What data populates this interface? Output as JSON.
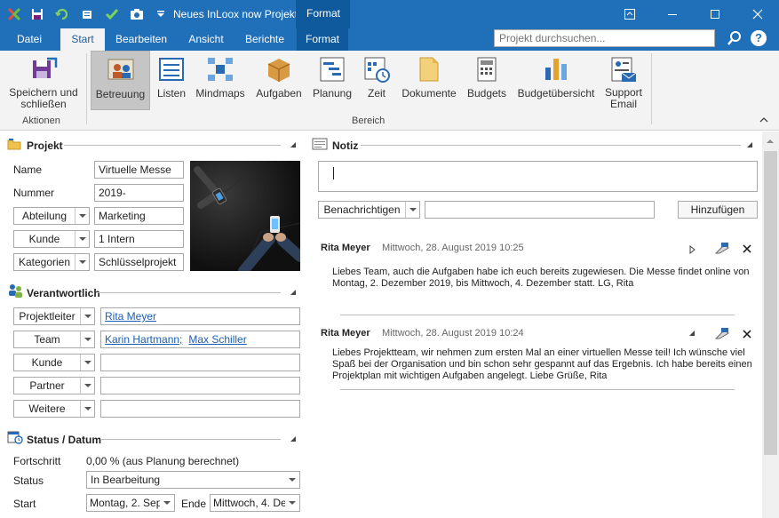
{
  "window": {
    "title": "Neues InLoox now Projekt",
    "context_tab": "Format",
    "colors": {
      "titlebar": "#1f6fb9",
      "context": "#0f5a9c",
      "ribbon": "#f3f3f3",
      "link": "#1a5fb4"
    }
  },
  "quick_access": [
    {
      "name": "app-logo-icon"
    },
    {
      "name": "save-icon"
    },
    {
      "name": "refresh-icon"
    },
    {
      "name": "print-icon"
    },
    {
      "name": "check-icon"
    },
    {
      "name": "camera-icon"
    },
    {
      "name": "customize-dropdown-icon"
    }
  ],
  "tabs": [
    {
      "label": "Datei"
    },
    {
      "label": "Start"
    },
    {
      "label": "Bearbeiten"
    },
    {
      "label": "Ansicht"
    },
    {
      "label": "Berichte"
    },
    {
      "label": "Format"
    }
  ],
  "search": {
    "placeholder": "Projekt durchsuchen..."
  },
  "ribbon": {
    "groups": {
      "actions": "Aktionen",
      "area": "Bereich"
    },
    "buttons": [
      {
        "label": "Speichern und schließen",
        "icon": "save-close-icon"
      },
      {
        "label": "Betreuung",
        "icon": "management-icon"
      },
      {
        "label": "Listen",
        "icon": "lists-icon"
      },
      {
        "label": "Mindmaps",
        "icon": "mindmap-icon"
      },
      {
        "label": "Aufgaben",
        "icon": "tasks-icon"
      },
      {
        "label": "Planung",
        "icon": "planning-icon"
      },
      {
        "label": "Zeit",
        "icon": "time-icon"
      },
      {
        "label": "Dokumente",
        "icon": "documents-icon"
      },
      {
        "label": "Budgets",
        "icon": "budgets-icon"
      },
      {
        "label": "Budgetübersicht",
        "icon": "budget-overview-icon"
      },
      {
        "label": "Support Email",
        "icon": "support-email-icon"
      }
    ]
  },
  "project": {
    "heading": "Projekt",
    "name_label": "Name",
    "name_value": "Virtuelle Messe",
    "number_label": "Nummer",
    "number_value": "2019-",
    "department_label": "Abteilung",
    "department_value": "Marketing",
    "customer_label": "Kunde",
    "customer_value": "1 Intern",
    "categories_label": "Kategorien",
    "categories_value": "Schlüsselprojekt"
  },
  "responsible": {
    "heading": "Verantwortlich",
    "leader_label": "Projektleiter",
    "leader_value": "Rita Meyer",
    "team_label": "Team",
    "team_members": [
      "Karin Hartmann;",
      "Max Schiller"
    ],
    "customer_label": "Kunde",
    "partner_label": "Partner",
    "more_label": "Weitere"
  },
  "status": {
    "heading": "Status / Datum",
    "progress_label": "Fortschritt",
    "progress_value": "0,00 % (aus Planung berechnet)",
    "status_label": "Status",
    "status_value": "In Bearbeitung",
    "start_label": "Start",
    "start_value": "Montag, 2. Sep",
    "end_label": "Ende",
    "end_value": "Mittwoch, 4. De"
  },
  "notes": {
    "heading": "Notiz",
    "notify_label": "Benachrichtigen",
    "add_label": "Hinzufügen",
    "items": [
      {
        "author": "Rita Meyer",
        "date": "Mittwoch, 28. August 2019 10:25",
        "body": "Liebes Team, auch die Aufgaben habe ich euch bereits zugewiesen. Die Messe findet online von Montag, 2. Dezember 2019, bis Mittwoch, 4. Dezember statt. LG, Rita"
      },
      {
        "author": "Rita Meyer",
        "date": "Mittwoch, 28. August 2019 10:24",
        "body": "Liebes Projektteam, wir nehmen zum ersten Mal an einer virtuellen Messe teil! Ich wünsche viel Spaß bei der Organisation und bin schon sehr gespannt auf das Ergebnis. Ich habe bereits einen Projektplan mit wichtigen Aufgaben angelegt. Liebe Grüße, Rita"
      }
    ]
  }
}
